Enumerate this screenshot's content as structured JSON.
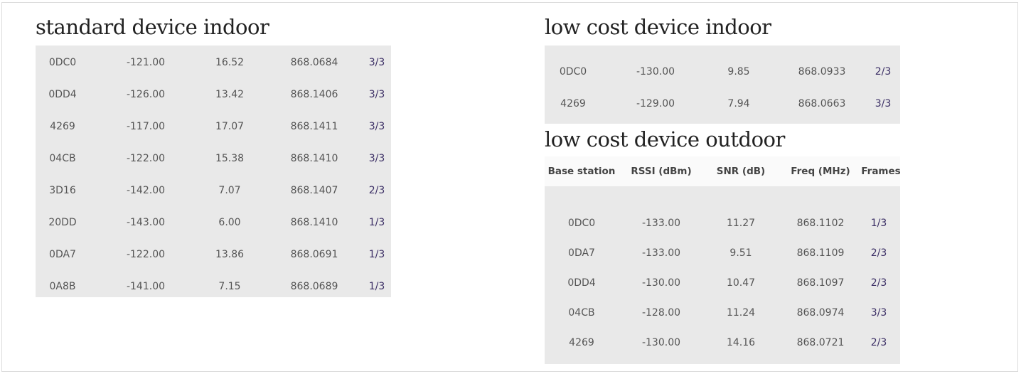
{
  "standard_indoor": {
    "title": "standard device indoor",
    "rows": [
      [
        "0DC0",
        "-121.00",
        "16.52",
        "868.0684",
        "3/3"
      ],
      [
        "0DD4",
        "-126.00",
        "13.42",
        "868.1406",
        "3/3"
      ],
      [
        "4269",
        "-117.00",
        "17.07",
        "868.1411",
        "3/3"
      ],
      [
        "04CB",
        "-122.00",
        "15.38",
        "868.1410",
        "3/3"
      ],
      [
        "3D16",
        "-142.00",
        "7.07",
        "868.1407",
        "2/3"
      ],
      [
        "20DD",
        "-143.00",
        "6.00",
        "868.1410",
        "1/3"
      ],
      [
        "0DA7",
        "-122.00",
        "13.86",
        "868.0691",
        "1/3"
      ],
      [
        "0A8B",
        "-141.00",
        "7.15",
        "868.0689",
        "1/3"
      ]
    ]
  },
  "lowcost_indoor": {
    "title": "low cost device indoor",
    "rows": [
      [
        "0DC0",
        "-130.00",
        "9.85",
        "868.0933",
        "2/3"
      ],
      [
        "4269",
        "-129.00",
        "7.94",
        "868.0663",
        "3/3"
      ]
    ]
  },
  "lowcost_outdoor": {
    "title": "low cost device outdoor",
    "headers": [
      "Base station",
      "RSSI (dBm)",
      "SNR (dB)",
      "Freq (MHz)",
      "Frames"
    ],
    "rows": [
      [
        "0DC0",
        "-133.00",
        "11.27",
        "868.1102",
        "1/3"
      ],
      [
        "0DA7",
        "-133.00",
        "9.51",
        "868.1109",
        "2/3"
      ],
      [
        "0DD4",
        "-130.00",
        "10.47",
        "868.1097",
        "2/3"
      ],
      [
        "04CB",
        "-128.00",
        "11.24",
        "868.0974",
        "3/3"
      ],
      [
        "4269",
        "-130.00",
        "14.16",
        "868.0721",
        "2/3"
      ]
    ]
  }
}
